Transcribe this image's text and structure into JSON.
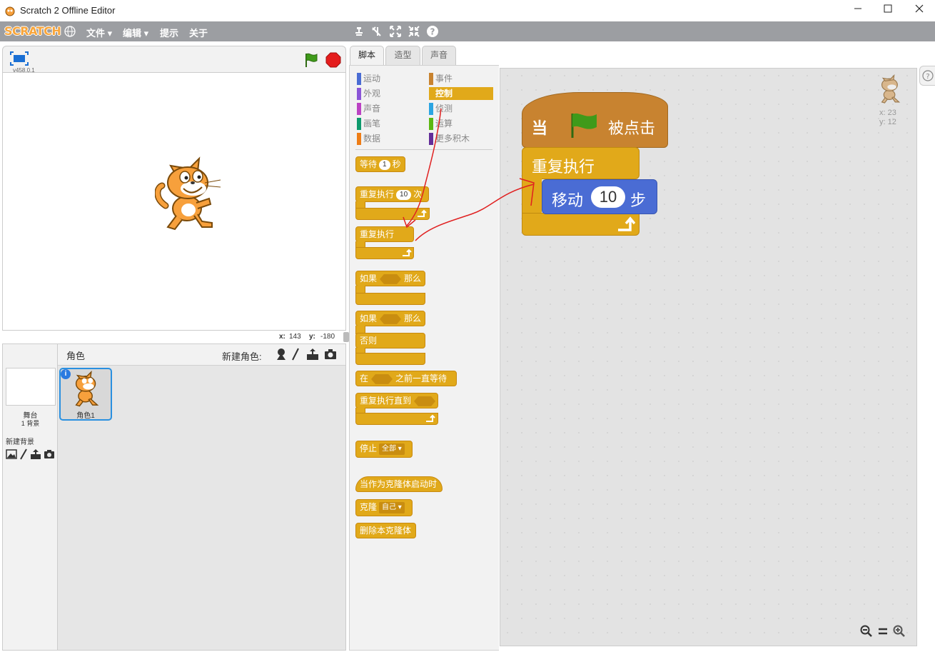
{
  "window": {
    "title": "Scratch 2 Offline Editor",
    "controls": [
      "minimize",
      "maximize",
      "close"
    ]
  },
  "menubar": {
    "logo": "SCRATCH",
    "items": [
      "文件 ▾",
      "编辑 ▾",
      "提示",
      "关于"
    ],
    "tools": [
      "duplicate-icon",
      "delete-icon",
      "grow-icon",
      "shrink-icon",
      "help-icon"
    ]
  },
  "stage": {
    "version": "v458.0.1",
    "mouse_x_label": "x:",
    "mouse_x": "143",
    "mouse_y_label": "y:",
    "mouse_y": "-180"
  },
  "sprites_panel": {
    "header": "角色",
    "new_sprite_label": "新建角色:",
    "stage_label": "舞台",
    "backdrop_count": "1 背景",
    "new_backdrop_label": "新建背景",
    "sprite_name": "角色1"
  },
  "tabs": [
    "脚本",
    "造型",
    "声音"
  ],
  "categories": [
    {
      "label": "运动",
      "color": "#4a6cd4"
    },
    {
      "label": "外观",
      "color": "#8a55d7"
    },
    {
      "label": "声音",
      "color": "#bb42c3"
    },
    {
      "label": "画笔",
      "color": "#0e9a6c"
    },
    {
      "label": "数据",
      "color": "#ee7d16"
    },
    {
      "label": "事件",
      "color": "#c88330"
    },
    {
      "label": "控制",
      "color": "#e1a91a"
    },
    {
      "label": "侦测",
      "color": "#2ca5e2"
    },
    {
      "label": "运算",
      "color": "#5cb712"
    },
    {
      "label": "更多积木",
      "color": "#632d99"
    }
  ],
  "palette": {
    "wait": {
      "pre": "等待",
      "val": "1",
      "post": "秒"
    },
    "repeat": {
      "pre": "重复执行",
      "val": "10",
      "post": "次"
    },
    "forever": "重复执行",
    "if_then": {
      "pre": "如果",
      "post": "那么"
    },
    "if_else": {
      "pre": "如果",
      "post": "那么",
      "else": "否则"
    },
    "wait_until": {
      "pre": "在",
      "post": "之前一直等待"
    },
    "repeat_until": "重复执行直到",
    "stop": {
      "pre": "停止",
      "option": "全部"
    },
    "clone_start": "当作为克隆体启动时",
    "clone": {
      "pre": "克隆",
      "option": "自己"
    },
    "delete_clone": "删除本克隆体"
  },
  "script": {
    "hat_pre": "当",
    "hat_post": "被点击",
    "forever": "重复执行",
    "move_pre": "移动",
    "move_val": "10",
    "move_post": "步",
    "sprite_x": "x: 23",
    "sprite_y": "y: 12"
  },
  "colors": {
    "control": "#e1a91a",
    "events": "#c88330",
    "motion": "#4a6cd4",
    "annotation": "#e02020"
  }
}
